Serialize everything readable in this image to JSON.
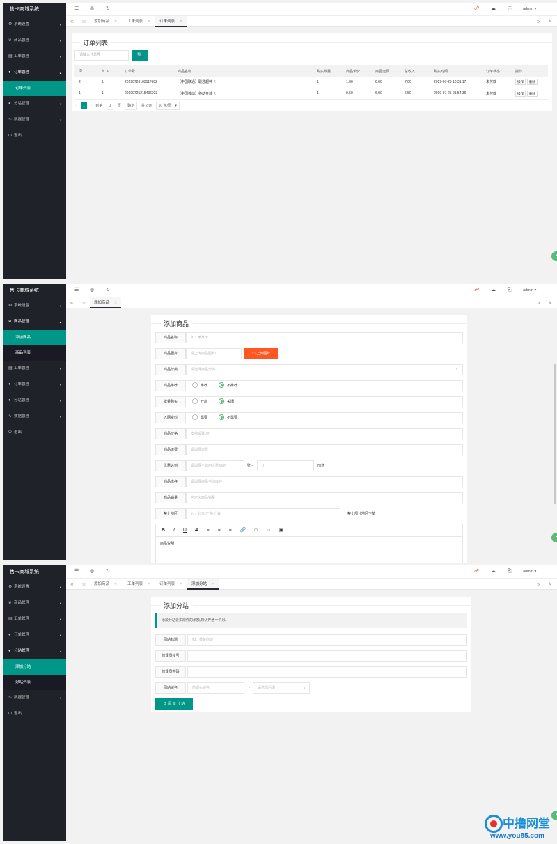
{
  "system_title": "售卡商城系统",
  "user": "admin",
  "icons": {
    "menu": "menu-icon",
    "globe": "globe-icon",
    "refresh": "refresh-icon",
    "home": "home-icon",
    "prev": "double-chevron-left-icon",
    "next": "double-chevron-right-icon",
    "more": "chevron-down-icon"
  },
  "sidebar": {
    "settings": "系统设置",
    "goods": "商品管理",
    "goods_add": "添加商品",
    "goods_list": "商品列表",
    "tickets": "工单管理",
    "orders": "订单管理",
    "orders_list": "订单列表",
    "sites": "分站管理",
    "sites_add": "添加分站",
    "sites_list": "分站列表",
    "data": "数据管理",
    "logout": "退出"
  },
  "tabs": {
    "add_goods": "添加商品",
    "ticket_list": "工单列表",
    "order_list": "订单列表",
    "add_site": "添加分站"
  },
  "orders_page": {
    "title": "订单列表",
    "search_placeholder": "请输入订单号",
    "columns": [
      "ID",
      "M_id",
      "订单号",
      "商品名称",
      "购买数量",
      "商品单价",
      "商品运费",
      "总收入",
      "购买时间",
      "订单状态",
      "操作"
    ],
    "rows": [
      {
        "id": "2",
        "mid": "1",
        "order_no": "20190726103117682",
        "name": "【中国联通】联通超神卡",
        "qty": "1",
        "price": "1.00",
        "freight": "6.00",
        "total": "7.00",
        "time": "2019-07-26 10:31:17",
        "status": "未付款"
      },
      {
        "id": "1",
        "mid": "1",
        "order_no": "20190725215436923",
        "name": "【中国移动】移动金城卡",
        "qty": "1",
        "price": "0.50",
        "freight": "6.00",
        "total": "6.50",
        "time": "2019-07-25 21:54:36",
        "status": "未付款"
      }
    ],
    "row_actions": [
      "操作",
      "删除"
    ],
    "pager": {
      "current": "1",
      "goto_label": "到第",
      "page_value": "1",
      "page_unit": "页",
      "confirm": "确定",
      "total": "共 2 条",
      "per_page": "10 条/页"
    }
  },
  "add_goods_page": {
    "title": "添加商品",
    "name_label": "商品名称",
    "name_ph": "如：某某卡",
    "img_label": "商品图片",
    "img_ph": "请上传商品图片!",
    "upload": "上传图片",
    "cat_label": "商品分类",
    "cat_ph": "请选择商品分类",
    "rec_label": "商品推荐",
    "rec_yes": "推荐",
    "rec_no": "不推荐",
    "bulk_label": "批量购买",
    "bulk_on": "开启",
    "bulk_off": "关闭",
    "net_label": "入网资料",
    "net_need": "需要",
    "net_noneed": "不需要",
    "price_label": "商品价格",
    "price_ph": "支持设置0元",
    "freight_label": "商品运费",
    "freight_ph": "请填写运费",
    "promo_label": "优惠达到",
    "promo_ph": "请填写不启用优惠功能",
    "promo_mid": "张 -",
    "promo_val_ph": "0",
    "promo_unit": "元/张",
    "stock_label": "商品库存",
    "stock_ph": "请填写商品当前库存",
    "sales_label": "商品销量",
    "sales_ph": "自定义商品销量",
    "ban_label": "禁止地区",
    "ban_ph": "入：北京|广东|上海",
    "ban_note": "禁止部分地区下单",
    "editor_tools": [
      "B",
      "I",
      "U",
      "S",
      "≡",
      "≡",
      "≡",
      "🔗",
      "□",
      "☺",
      "▣"
    ],
    "desc": "商品说明"
  },
  "add_site_page": {
    "title": "添加分站",
    "notice": "添加分站会扣除你的余额,默认开通一个月。",
    "site_title_label": "网站标题",
    "site_title_ph": "如：某某商城",
    "admin_label": "管理员帐号",
    "pwd_label": "管理员密码",
    "domain_label": "网站域名",
    "domain_ph": "前缀头域名",
    "domain_sep": "-",
    "domain_select_ph": "请选择后缀",
    "submit": "添 加 分 站"
  },
  "watermark": {
    "title": "中撸网堂",
    "url": "www.you85.com"
  }
}
